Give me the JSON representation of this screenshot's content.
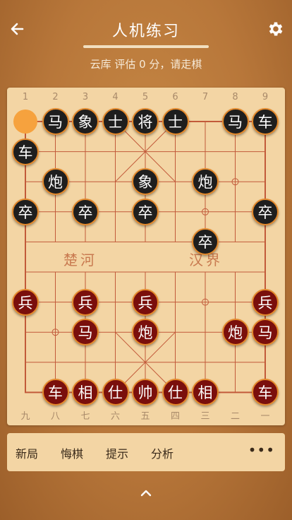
{
  "header": {
    "title": "人机练习",
    "back_icon": "back-arrow-icon",
    "settings_icon": "gear-icon"
  },
  "status": "云库 评估 0 分，请走棋",
  "board": {
    "top_numbers": [
      "1",
      "2",
      "3",
      "4",
      "5",
      "6",
      "7",
      "8",
      "9"
    ],
    "bottom_numbers": [
      "九",
      "八",
      "七",
      "六",
      "五",
      "四",
      "三",
      "二",
      "一"
    ],
    "river_left": "楚河",
    "river_right": "汉界",
    "last_move_from": {
      "col": 1,
      "row": 1
    },
    "pieces": [
      {
        "side": "black",
        "label": "马",
        "col": 2,
        "row": 1
      },
      {
        "side": "black",
        "label": "象",
        "col": 3,
        "row": 1
      },
      {
        "side": "black",
        "label": "士",
        "col": 4,
        "row": 1
      },
      {
        "side": "black",
        "label": "将",
        "col": 5,
        "row": 1
      },
      {
        "side": "black",
        "label": "士",
        "col": 6,
        "row": 1
      },
      {
        "side": "black",
        "label": "马",
        "col": 8,
        "row": 1
      },
      {
        "side": "black",
        "label": "车",
        "col": 9,
        "row": 1
      },
      {
        "side": "black",
        "label": "车",
        "col": 1,
        "row": 2,
        "selected": true
      },
      {
        "side": "black",
        "label": "炮",
        "col": 2,
        "row": 3
      },
      {
        "side": "black",
        "label": "象",
        "col": 5,
        "row": 3
      },
      {
        "side": "black",
        "label": "炮",
        "col": 7,
        "row": 3
      },
      {
        "side": "black",
        "label": "卒",
        "col": 1,
        "row": 4
      },
      {
        "side": "black",
        "label": "卒",
        "col": 3,
        "row": 4
      },
      {
        "side": "black",
        "label": "卒",
        "col": 5,
        "row": 4
      },
      {
        "side": "black",
        "label": "卒",
        "col": 9,
        "row": 4
      },
      {
        "side": "black",
        "label": "卒",
        "col": 7,
        "row": 5
      },
      {
        "side": "red",
        "label": "兵",
        "col": 1,
        "row": 7
      },
      {
        "side": "red",
        "label": "兵",
        "col": 3,
        "row": 7
      },
      {
        "side": "red",
        "label": "兵",
        "col": 5,
        "row": 7
      },
      {
        "side": "red",
        "label": "兵",
        "col": 9,
        "row": 7
      },
      {
        "side": "red",
        "label": "马",
        "col": 3,
        "row": 8
      },
      {
        "side": "red",
        "label": "炮",
        "col": 5,
        "row": 8
      },
      {
        "side": "red",
        "label": "炮",
        "col": 8,
        "row": 8
      },
      {
        "side": "red",
        "label": "马",
        "col": 9,
        "row": 8
      },
      {
        "side": "red",
        "label": "车",
        "col": 2,
        "row": 10
      },
      {
        "side": "red",
        "label": "相",
        "col": 3,
        "row": 10
      },
      {
        "side": "red",
        "label": "仕",
        "col": 4,
        "row": 10
      },
      {
        "side": "red",
        "label": "帅",
        "col": 5,
        "row": 10
      },
      {
        "side": "red",
        "label": "仕",
        "col": 6,
        "row": 10
      },
      {
        "side": "red",
        "label": "相",
        "col": 7,
        "row": 10
      },
      {
        "side": "red",
        "label": "车",
        "col": 9,
        "row": 10
      }
    ]
  },
  "actions": [
    "新局",
    "悔棋",
    "提示",
    "分析"
  ],
  "more_label": "•••",
  "colors": {
    "background": "#b8773a",
    "board": "#f3d5a4",
    "grid_line": "#c25a3a",
    "piece_black": "#1e1e1e",
    "piece_red": "#7a0f0c",
    "piece_border": "#e58a2c",
    "last_move_marker": "#f6a23e"
  }
}
